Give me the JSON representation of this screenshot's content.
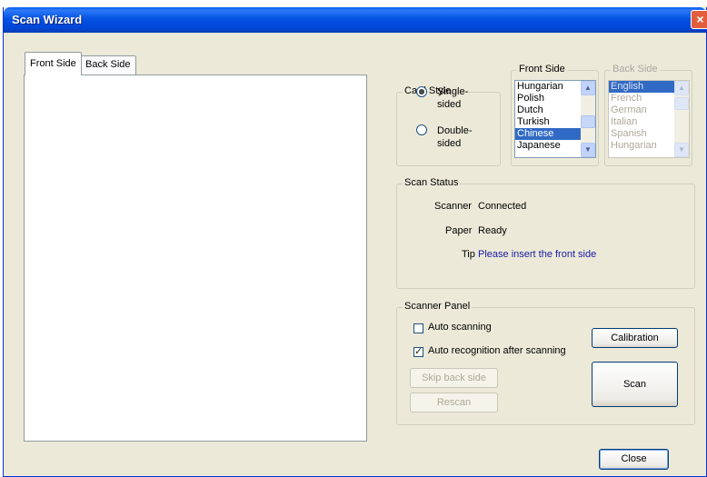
{
  "window": {
    "title": "Scan Wizard",
    "close_glyph": "×"
  },
  "tabs": [
    {
      "label": "Front Side",
      "active": true
    },
    {
      "label": "Back Side",
      "active": false
    }
  ],
  "card_style": {
    "legend": "Card Style",
    "options": [
      {
        "label_line1": "Single-",
        "label_line2": "sided",
        "checked": true
      },
      {
        "label_line1": "Double-",
        "label_line2": "sided",
        "checked": false
      }
    ]
  },
  "front_side": {
    "legend": "Front Side",
    "items": [
      "Hungarian",
      "Polish",
      "Dutch",
      "Turkish",
      "Chinese",
      "Japanese"
    ],
    "selected": "Chinese"
  },
  "back_side": {
    "legend": "Back Side",
    "enabled": false,
    "items": [
      "English",
      "French",
      "German",
      "Italian",
      "Spanish",
      "Hungarian"
    ],
    "selected": "English"
  },
  "scan_status": {
    "legend": "Scan Status",
    "rows": [
      {
        "label": "Scanner",
        "value": "Connected"
      },
      {
        "label": "Paper",
        "value": "Ready"
      },
      {
        "label": "Tip",
        "value": "Please insert the front side"
      }
    ]
  },
  "scanner_panel": {
    "legend": "Scanner Panel",
    "auto_scanning": {
      "label": "Auto scanning",
      "checked": false
    },
    "auto_recognition": {
      "label": "Auto recognition after scanning",
      "checked": true
    },
    "calibration_label": "Calibration",
    "scan_label": "Scan",
    "skip_back_side_label": "Skip back side",
    "rescan_label": "Rescan"
  },
  "close_label": "Close",
  "colors": {
    "title_bar": "#0452e3",
    "dialog_bg": "#ece9d8",
    "selection": "#316ac5",
    "tip_text": "#1a1aa6"
  }
}
